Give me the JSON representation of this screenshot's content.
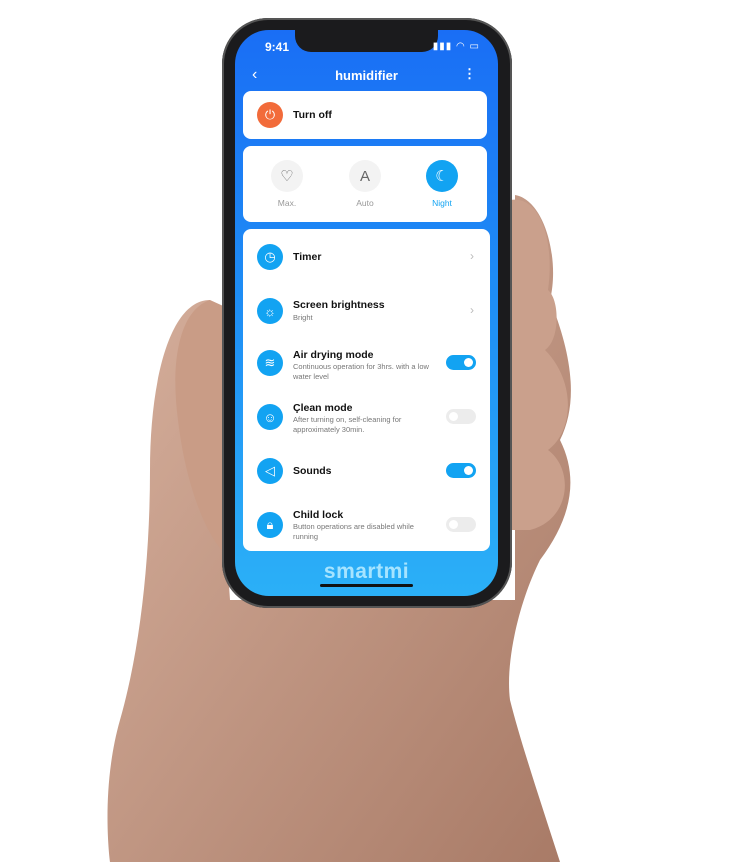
{
  "status_bar": {
    "time": "9:41",
    "icons": [
      "signal-icon",
      "wifi-icon",
      "battery-icon"
    ]
  },
  "header": {
    "title": "humidifier",
    "back_icon": "chevron-left-icon",
    "menu_icon": "more-vertical-icon"
  },
  "power": {
    "label": "Turn off",
    "icon": "power-icon",
    "color": "#f26b3a"
  },
  "modes": [
    {
      "label": "Max.",
      "icon": "heart-icon",
      "selected": false
    },
    {
      "label": "Auto",
      "icon": "letter-a-icon",
      "selected": false
    },
    {
      "label": "Night",
      "icon": "moon-icon",
      "selected": true
    }
  ],
  "settings": [
    {
      "title": "Timer",
      "subtitle": "",
      "icon": "clock-icon",
      "control": "chevron"
    },
    {
      "title": "Screen brightness",
      "subtitle": "Bright",
      "icon": "brightness-icon",
      "control": "chevron"
    },
    {
      "title": "Air drying mode",
      "subtitle": "Continuous operation for 3hrs. with a low water level",
      "icon": "waves-icon",
      "control": "toggle",
      "on": true
    },
    {
      "title": "Çlean mode",
      "subtitle": "After turning on, self-cleaning for approximately 30min.",
      "icon": "clean-icon",
      "control": "toggle",
      "on": false
    },
    {
      "title": "Sounds",
      "subtitle": "",
      "icon": "speaker-icon",
      "control": "toggle",
      "on": true
    },
    {
      "title": "Child lock",
      "subtitle": "Button operations are disabled while running",
      "icon": "lock-icon",
      "control": "toggle",
      "on": false
    }
  ],
  "brand": "smartmi",
  "colors": {
    "accent": "#12a3f2",
    "header_gradient_top": "#1a6ef5",
    "header_gradient_bottom": "#2bb0f7"
  }
}
